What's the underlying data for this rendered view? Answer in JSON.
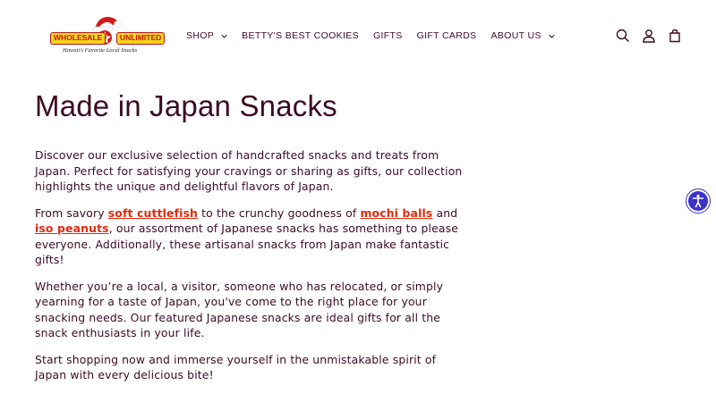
{
  "logo": {
    "word_left": "WHOLESALE",
    "word_right": "UNLIMITED",
    "tagline": "Hawaii's Favorite Local Snacks"
  },
  "nav": {
    "items": [
      {
        "label": "SHOP",
        "has_dropdown": true
      },
      {
        "label": "BETTY'S BEST COOKIES",
        "has_dropdown": false
      },
      {
        "label": "GIFTS",
        "has_dropdown": false
      },
      {
        "label": "GIFT CARDS",
        "has_dropdown": false
      },
      {
        "label": "ABOUT US",
        "has_dropdown": true
      }
    ]
  },
  "header_icons": [
    "search-icon",
    "account-icon",
    "cart-icon"
  ],
  "page": {
    "title": "Made in Japan Snacks",
    "paragraph1": "Discover our exclusive selection of handcrafted snacks and treats from Japan. Perfect for satisfying your cravings or sharing as gifts, our collection highlights the unique and delightful flavors of Japan.",
    "paragraph2": {
      "t1": "From savory ",
      "link1": "soft cuttlefish",
      "t2": " to the crunchy goodness of ",
      "link2": "mochi balls",
      "t3": " and ",
      "link3": "iso peanuts",
      "t4": ", our assortment of Japanese snacks has something to please everyone. Additionally, these artisanal snacks from Japan make fantastic gifts!"
    },
    "paragraph3": "Whether you’re a local, a visitor, someone who has relocated, or simply yearning for a taste of Japan, you've come to the right place for your snacking needs. Our featured Japanese snacks are ideal gifts for all the snack enthusiasts in your life.",
    "paragraph4": "Start shopping now and immerse yourself in the unmistakable spirit of Japan with every delicious bite!"
  },
  "colors": {
    "text": "#3d0a24",
    "link": "#e02a0d",
    "accessibility": "#3b33c9"
  }
}
